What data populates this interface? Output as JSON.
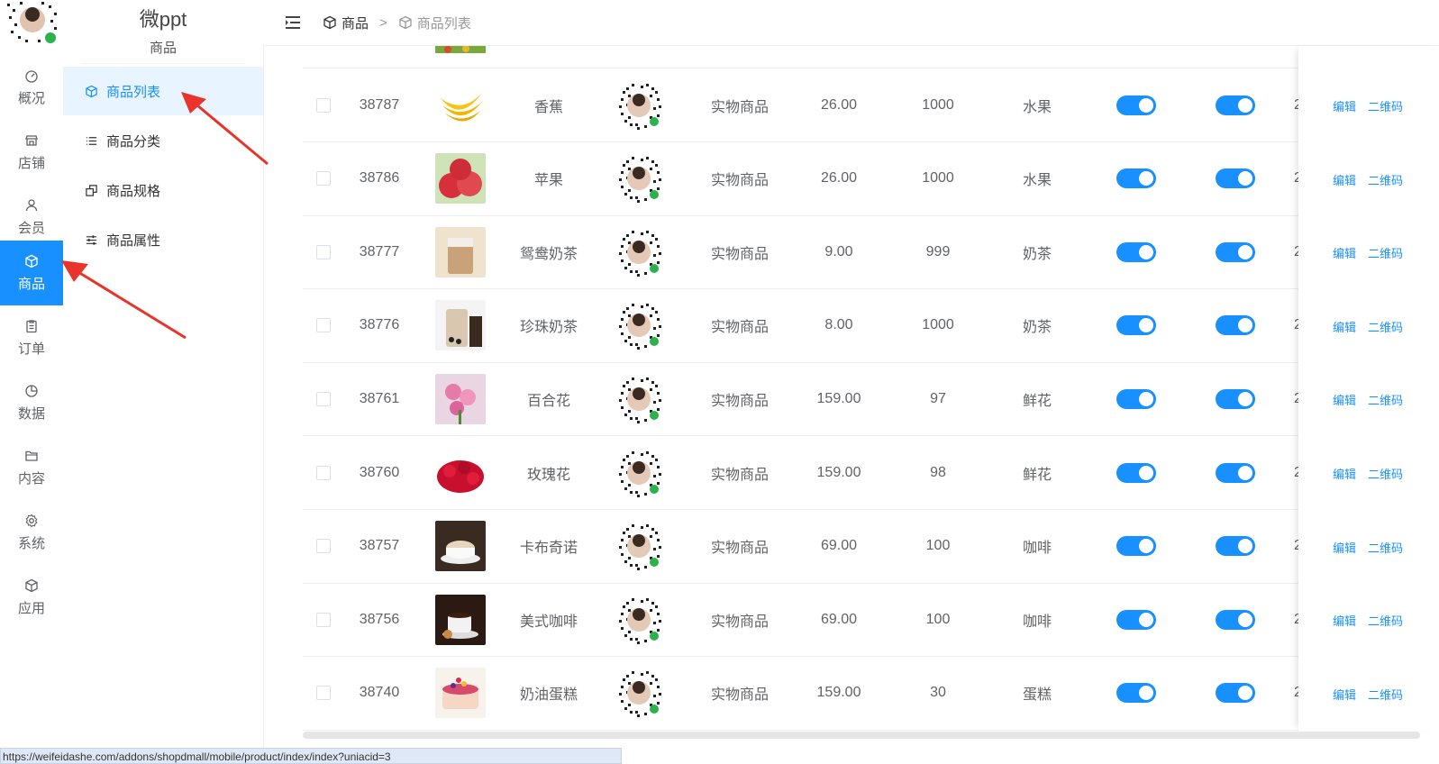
{
  "sidebar": {
    "items": [
      {
        "label": "概况",
        "icon": "dashboard-icon"
      },
      {
        "label": "店铺",
        "icon": "shop-icon"
      },
      {
        "label": "会员",
        "icon": "user-icon"
      },
      {
        "label": "商品",
        "icon": "box-icon",
        "active": true
      },
      {
        "label": "订单",
        "icon": "clipboard-icon"
      },
      {
        "label": "数据",
        "icon": "pie-chart-icon"
      },
      {
        "label": "内容",
        "icon": "folder-icon"
      },
      {
        "label": "系统",
        "icon": "gear-icon"
      },
      {
        "label": "应用",
        "icon": "box-icon"
      }
    ]
  },
  "subnav": {
    "brand": "微ppt",
    "section": "商品",
    "items": [
      {
        "label": "商品列表",
        "icon": "box-icon",
        "active": true
      },
      {
        "label": "商品分类",
        "icon": "list-icon"
      },
      {
        "label": "商品规格",
        "icon": "copy-icon"
      },
      {
        "label": "商品属性",
        "icon": "sliders-icon"
      }
    ]
  },
  "breadcrumb": {
    "first": "商品",
    "separator": ">",
    "second": "商品列表"
  },
  "table": {
    "rows": [
      {
        "id": "38787",
        "name": "香蕉",
        "type": "实物商品",
        "price": "26.00",
        "stock": "1000",
        "category": "水果"
      },
      {
        "id": "38786",
        "name": "苹果",
        "type": "实物商品",
        "price": "26.00",
        "stock": "1000",
        "category": "水果"
      },
      {
        "id": "38777",
        "name": "鸳鸯奶茶",
        "type": "实物商品",
        "price": "9.00",
        "stock": "999",
        "category": "奶茶"
      },
      {
        "id": "38776",
        "name": "珍珠奶茶",
        "type": "实物商品",
        "price": "8.00",
        "stock": "1000",
        "category": "奶茶"
      },
      {
        "id": "38761",
        "name": "百合花",
        "type": "实物商品",
        "price": "159.00",
        "stock": "97",
        "category": "鲜花"
      },
      {
        "id": "38760",
        "name": "玫瑰花",
        "type": "实物商品",
        "price": "159.00",
        "stock": "98",
        "category": "鲜花"
      },
      {
        "id": "38757",
        "name": "卡布奇诺",
        "type": "实物商品",
        "price": "69.00",
        "stock": "100",
        "category": "咖啡"
      },
      {
        "id": "38756",
        "name": "美式咖啡",
        "type": "实物商品",
        "price": "69.00",
        "stock": "100",
        "category": "咖啡"
      },
      {
        "id": "38740",
        "name": "奶油蛋糕",
        "type": "实物商品",
        "price": "159.00",
        "stock": "30",
        "category": "蛋糕"
      }
    ],
    "actions": {
      "edit": "编辑",
      "qrcode": "二维码"
    },
    "truncated_col": "2"
  },
  "statusbar": "https://weifeidashe.com/addons/shopdmall/mobile/product/index/index?uniacid=3"
}
